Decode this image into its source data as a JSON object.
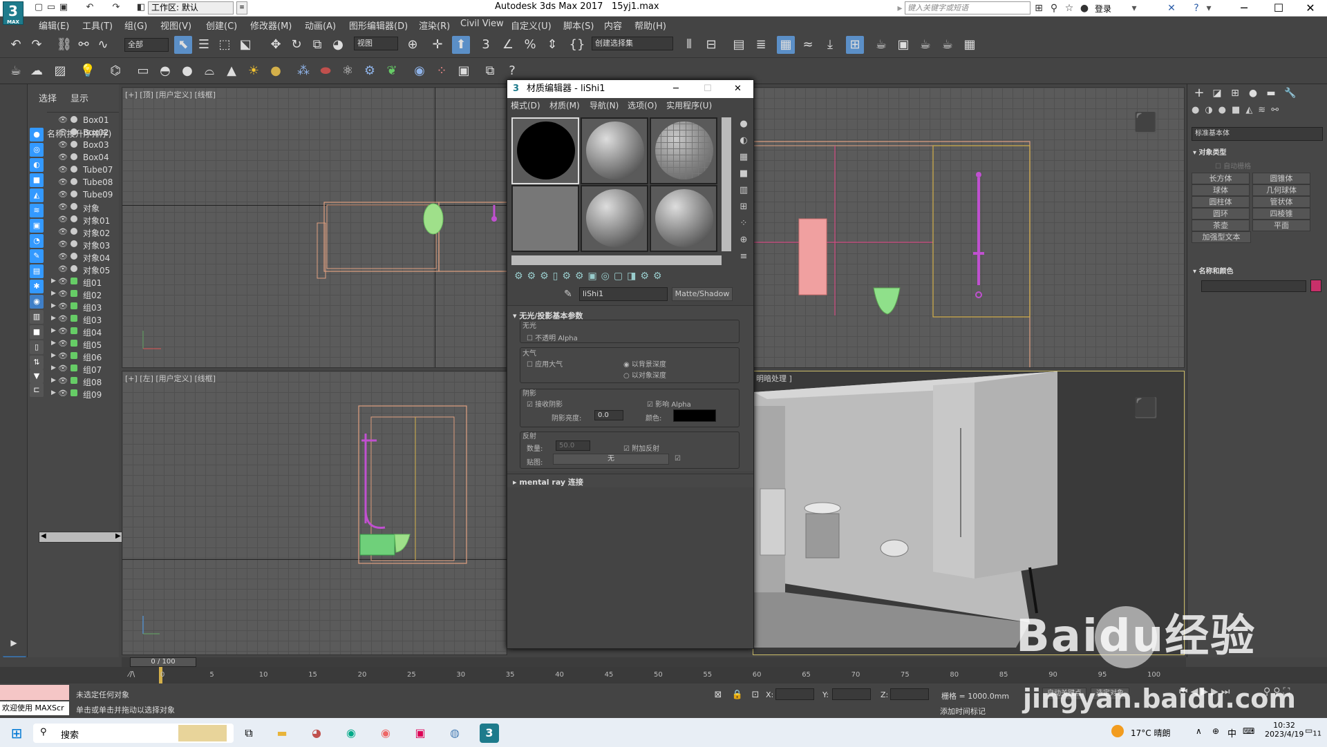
{
  "titlebar": {
    "logo_text": "3",
    "logo_sub": "MAX",
    "workspace": "工作区: 默认",
    "app_title": "Autodesk 3ds Max 2017",
    "file_name": "15yj1.max",
    "search_placeholder": "键入关键字或短语",
    "login": "登录"
  },
  "menu": [
    "编辑(E)",
    "工具(T)",
    "组(G)",
    "视图(V)",
    "创建(C)",
    "修改器(M)",
    "动画(A)",
    "图形编辑器(D)",
    "渲染(R)",
    "Civil View",
    "自定义(U)",
    "脚本(S)",
    "内容",
    "帮助(H)"
  ],
  "toolbar": {
    "selection_filter": "全部",
    "ref_coord": "视图",
    "named_selection": "创建选择集"
  },
  "scene_explorer": {
    "tabs": [
      "选择",
      "显示"
    ],
    "header": "名称(按升序排序)",
    "items": [
      {
        "label": "Box01",
        "group": false
      },
      {
        "label": "Box02",
        "group": false
      },
      {
        "label": "Box03",
        "group": false
      },
      {
        "label": "Box04",
        "group": false
      },
      {
        "label": "Tube07",
        "group": false
      },
      {
        "label": "Tube08",
        "group": false
      },
      {
        "label": "Tube09",
        "group": false
      },
      {
        "label": "对象",
        "group": false
      },
      {
        "label": "对象01",
        "group": false
      },
      {
        "label": "对象02",
        "group": false
      },
      {
        "label": "对象03",
        "group": false
      },
      {
        "label": "对象04",
        "group": false
      },
      {
        "label": "对象05",
        "group": false
      },
      {
        "label": "组01",
        "group": true
      },
      {
        "label": "组02",
        "group": true
      },
      {
        "label": "组03",
        "group": true
      },
      {
        "label": "组03",
        "group": true
      },
      {
        "label": "组04",
        "group": true
      },
      {
        "label": "组05",
        "group": true
      },
      {
        "label": "组06",
        "group": true
      },
      {
        "label": "组07",
        "group": true
      },
      {
        "label": "组08",
        "group": true
      },
      {
        "label": "组09",
        "group": true
      }
    ]
  },
  "viewports": {
    "top_left": "[+] [顶] [用户定义] [线框]",
    "bottom_left": "[+] [左] [用户定义] [线框]",
    "bottom_right": "明暗处理 ]"
  },
  "material_editor": {
    "title": "材质编辑器 - liShi1",
    "menus": [
      "模式(D)",
      "材质(M)",
      "导航(N)",
      "选项(O)",
      "实用程序(U)"
    ],
    "material_name": "liShi1",
    "material_type": "Matte/Shadow",
    "rollout_title": "无光/投影基本参数",
    "matte_group": "无光",
    "opaque_alpha": "不透明 Alpha",
    "atmosphere_group": "大气",
    "apply_atmosphere": "应用大气",
    "at_bg_depth": "以背景深度",
    "at_obj_depth": "以对象深度",
    "shadow_group": "阴影",
    "receive_shadows": "接收阴影",
    "affect_alpha": "影响 Alpha",
    "shadow_brightness_label": "阴影亮度:",
    "shadow_brightness": "0.0",
    "color_label": "颜色:",
    "shadow_color": "#000000",
    "reflection_group": "反射",
    "amount_label": "数量:",
    "amount": "50.0",
    "additive_reflection": "附加反射",
    "map_label": "贴图:",
    "map_value": "无",
    "mental_ray": "mental ray 连接"
  },
  "command_panel": {
    "dropdown": "标准基本体",
    "object_type_title": "对象类型",
    "autogrid": "自动栅格",
    "buttons": [
      "长方体",
      "圆锥体",
      "球体",
      "几何球体",
      "圆柱体",
      "管状体",
      "圆环",
      "四棱锥",
      "茶壶",
      "平面",
      "加强型文本"
    ],
    "name_color_title": "名称和颜色",
    "object_color": "#c8306a"
  },
  "timeline": {
    "frame_display": "0 / 100",
    "ticks": [
      "0",
      "5",
      "10",
      "15",
      "20",
      "25",
      "30",
      "35",
      "40",
      "45",
      "50",
      "55",
      "60",
      "65",
      "70",
      "75",
      "80",
      "85",
      "90",
      "95",
      "100"
    ]
  },
  "status": {
    "welcome": "欢迎使用 MAXScr",
    "line1": "未选定任何对象",
    "line2": "单击或单击并拖动以选择对象",
    "x_label": "X:",
    "y_label": "Y:",
    "z_label": "Z:",
    "grid": "栅格 = 1000.0mm",
    "add_time_tag": "添加时间标记",
    "auto_key": "自动关键点",
    "selected_obj": "选定对象"
  },
  "taskbar": {
    "search": "搜索",
    "weather": "17°C 晴朗",
    "ime": "中",
    "time": "10:32",
    "date": "2023/4/19",
    "notif_count": "11"
  },
  "watermark": {
    "brand": "Baidu经验",
    "url": "jingyan.baidu.com"
  }
}
